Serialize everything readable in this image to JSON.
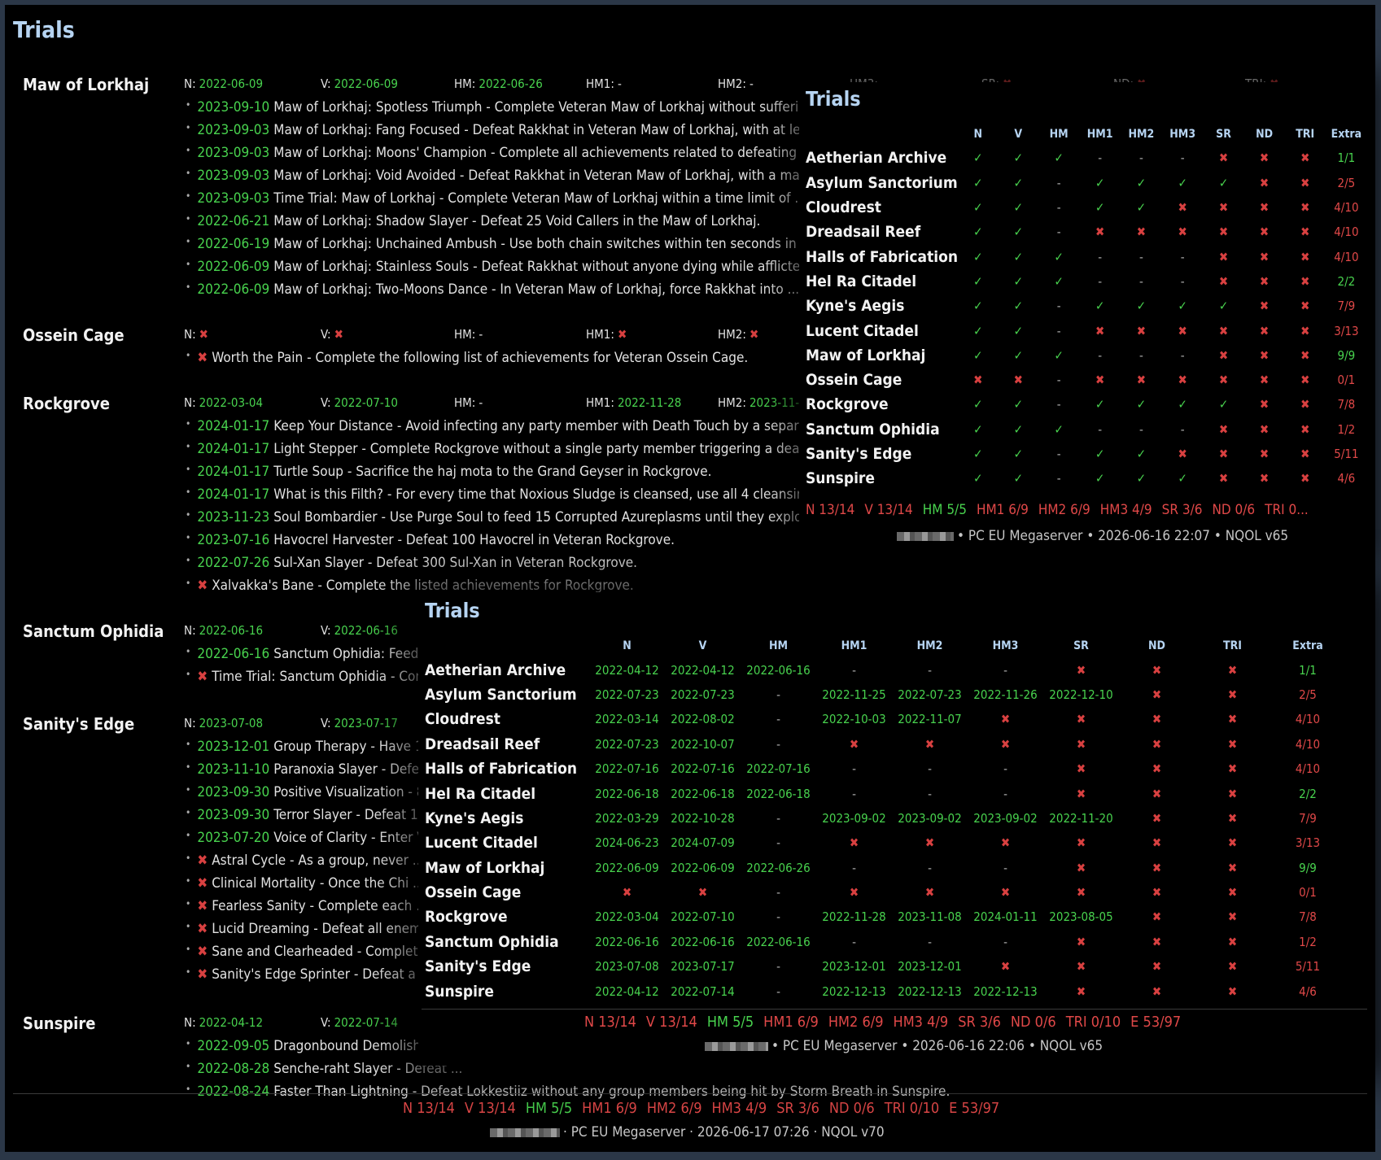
{
  "main": {
    "title": "Trials",
    "trials": [
      {
        "name": "Maw of Lorkhaj",
        "stats": [
          {
            "label": "N:",
            "value": "2022-06-09",
            "status": "date"
          },
          {
            "label": "V:",
            "value": "2022-06-09",
            "status": "date"
          },
          {
            "label": "HM:",
            "value": "2022-06-26",
            "status": "date"
          },
          {
            "label": "HM1:",
            "value": "-",
            "status": "dash"
          },
          {
            "label": "HM2:",
            "value": "-",
            "status": "dash"
          },
          {
            "label": "HM3:",
            "value": "-",
            "status": "dash"
          },
          {
            "label": "SR:",
            "value": "✖",
            "status": "x"
          },
          {
            "label": "ND:",
            "value": "✖",
            "status": "x"
          },
          {
            "label": "TRI:",
            "value": "✖",
            "status": "x"
          }
        ],
        "achievements": [
          {
            "date": "2023-09-10",
            "text": "Maw of Lorkhaj: Spotless Triumph - Complete Veteran Maw of Lorkhaj without suffering a death."
          },
          {
            "date": "2023-09-03",
            "text": "Maw of Lorkhaj: Fang Focused - Defeat Rakkhat in Veteran Maw of Lorkhaj, with at least ..."
          },
          {
            "date": "2023-09-03",
            "text": "Maw of Lorkhaj: Moons' Champion - Complete all achievements related to defeating Rakkhat."
          },
          {
            "date": "2023-09-03",
            "text": "Maw of Lorkhaj: Void Avoided - Defeat Rakkhat in Veteran Maw of Lorkhaj, with a maximum of ..."
          },
          {
            "date": "2023-09-03",
            "text": "Time Trial: Maw of Lorkhaj - Complete Veteran Maw of Lorkhaj within a time limit of ..."
          },
          {
            "date": "2022-06-21",
            "text": "Maw of Lorkhaj: Shadow Slayer - Defeat 25 Void Callers in the Maw of Lorkhaj."
          },
          {
            "date": "2022-06-19",
            "text": "Maw of Lorkhaj: Unchained Ambush - Use both chain switches within ten seconds in ..."
          },
          {
            "date": "2022-06-09",
            "text": "Maw of Lorkhaj: Stainless Souls - Defeat Rakkhat without anyone dying while afflicted ..."
          },
          {
            "date": "2022-06-09",
            "text": "Maw of Lorkhaj: Two-Moons Dance - In Veteran Maw of Lorkhaj, force Rakkhat into ..."
          }
        ]
      },
      {
        "name": "Ossein Cage",
        "stats": [
          {
            "label": "N:",
            "value": "✖",
            "status": "x"
          },
          {
            "label": "V:",
            "value": "✖",
            "status": "x"
          },
          {
            "label": "HM:",
            "value": "-",
            "status": "dash"
          },
          {
            "label": "HM1:",
            "value": "✖",
            "status": "x"
          },
          {
            "label": "HM2:",
            "value": "✖",
            "status": "x"
          }
        ],
        "achievements": [
          {
            "date": "",
            "text": "Worth the Pain - Complete the following list of achievements for Veteran Ossein Cage."
          }
        ]
      },
      {
        "name": "Rockgrove",
        "stats": [
          {
            "label": "N:",
            "value": "2022-03-04",
            "status": "date"
          },
          {
            "label": "V:",
            "value": "2022-07-10",
            "status": "date"
          },
          {
            "label": "HM:",
            "value": "-",
            "status": "dash"
          },
          {
            "label": "HM1:",
            "value": "2022-11-28",
            "status": "date"
          },
          {
            "label": "HM2:",
            "value": "2023-11-08",
            "status": "date"
          }
        ],
        "achievements": [
          {
            "date": "2024-01-17",
            "text": "Keep Your Distance - Avoid infecting any party member with Death Touch by a separation ..."
          },
          {
            "date": "2024-01-17",
            "text": "Light Stepper - Complete Rockgrove without a single party member triggering a deadly ..."
          },
          {
            "date": "2024-01-17",
            "text": "Turtle Soup - Sacrifice the haj mota to the Grand Geyser in Rockgrove."
          },
          {
            "date": "2024-01-17",
            "text": "What is this Filth? - For every time that Noxious Sludge is cleansed, use all 4 cleansing ..."
          },
          {
            "date": "2023-11-23",
            "text": "Soul Bombardier - Use Purge Soul to feed 15 Corrupted Azureplasms until they explode ..."
          },
          {
            "date": "2023-07-16",
            "text": "Havocrel Harvester - Defeat 100 Havocrel in Veteran Rockgrove."
          },
          {
            "date": "2022-07-26",
            "text": "Sul-Xan Slayer - Defeat 300 Sul-Xan in Veteran Rockgrove."
          },
          {
            "date": "",
            "text": "Xalvakka's Bane - Complete the listed achievements for Rockgrove."
          }
        ]
      },
      {
        "name": "Sanctum Ophidia",
        "stats": [
          {
            "label": "N:",
            "value": "2022-06-16",
            "status": "date"
          },
          {
            "label": "V:",
            "value": "2022-06-16",
            "status": "date"
          }
        ],
        "achievements": [
          {
            "date": "2022-06-16",
            "text": "Sanctum Ophidia: Feeding ..."
          },
          {
            "date": "",
            "text": "Time Trial: Sanctum Ophidia - Complete ..."
          }
        ]
      },
      {
        "name": "Sanity's Edge",
        "stats": [
          {
            "label": "N:",
            "value": "2023-07-08",
            "status": "date"
          },
          {
            "label": "V:",
            "value": "2023-07-17",
            "status": "date"
          }
        ],
        "achievements": [
          {
            "date": "2023-12-01",
            "text": "Group Therapy - Have 11 ..."
          },
          {
            "date": "2023-11-10",
            "text": "Paranoxia Slayer - Defeat ..."
          },
          {
            "date": "2023-09-30",
            "text": "Positive Visualization - 8 ..."
          },
          {
            "date": "2023-09-30",
            "text": "Terror Slayer - Defeat 12 ..."
          },
          {
            "date": "2023-07-20",
            "text": "Voice of Clarity - Enter V ..."
          },
          {
            "date": "",
            "text": "Astral Cycle - As a group, never ..."
          },
          {
            "date": "",
            "text": "Clinical Mortality - Once the Chi ..."
          },
          {
            "date": "",
            "text": "Fearless Sanity - Complete each ..."
          },
          {
            "date": "",
            "text": "Lucid Dreaming - Defeat all enem ..."
          },
          {
            "date": "",
            "text": "Sane and Clearheaded - Complete ..."
          },
          {
            "date": "",
            "text": "Sanity's Edge Sprinter - Defeat a ..."
          }
        ]
      },
      {
        "name": "Sunspire",
        "stats": [
          {
            "label": "N:",
            "value": "2022-04-12",
            "status": "date"
          },
          {
            "label": "V:",
            "value": "2022-07-14",
            "status": "date"
          }
        ],
        "achievements": [
          {
            "date": "2022-09-05",
            "text": "Dragonbound Demolisher - ..."
          },
          {
            "date": "2022-08-28",
            "text": "Senche-raht Slayer - Defeat ..."
          },
          {
            "date": "2022-08-24",
            "text": "Faster Than Lightning - Defeat Lokkestiiz without any group members being hit by Storm Breath in Sunspire."
          }
        ]
      }
    ],
    "summary": [
      {
        "text": "N 13/14",
        "status": "red"
      },
      {
        "text": "V 13/14",
        "status": "red"
      },
      {
        "text": "HM 5/5",
        "status": "green"
      },
      {
        "text": "HM1 6/9",
        "status": "red"
      },
      {
        "text": "HM2 6/9",
        "status": "red"
      },
      {
        "text": "HM3 4/9",
        "status": "red"
      },
      {
        "text": "SR 3/6",
        "status": "red"
      },
      {
        "text": "ND 0/6",
        "status": "red"
      },
      {
        "text": "TRI 0/10",
        "status": "red"
      },
      {
        "text": "E 53/97",
        "status": "red"
      }
    ],
    "footer": "· PC EU Megaserver · 2026-06-17 07:26 · NQOL v70"
  },
  "overlay1": {
    "title": "Trials",
    "columns": [
      "N",
      "V",
      "HM",
      "HM1",
      "HM2",
      "HM3",
      "SR",
      "ND",
      "TRI",
      "Extra"
    ],
    "rows": [
      {
        "name": "Aetherian Archive",
        "cells": [
          "✓",
          "✓",
          "✓",
          "-",
          "-",
          "-",
          "✖",
          "✖",
          "✖"
        ],
        "extra": "1/1"
      },
      {
        "name": "Asylum Sanctorium",
        "cells": [
          "✓",
          "✓",
          "-",
          "✓",
          "✓",
          "✓",
          "✓",
          "✖",
          "✖"
        ],
        "extra": "2/5"
      },
      {
        "name": "Cloudrest",
        "cells": [
          "✓",
          "✓",
          "-",
          "✓",
          "✓",
          "✖",
          "✖",
          "✖",
          "✖"
        ],
        "extra": "4/10"
      },
      {
        "name": "Dreadsail Reef",
        "cells": [
          "✓",
          "✓",
          "-",
          "✖",
          "✖",
          "✖",
          "✖",
          "✖",
          "✖"
        ],
        "extra": "4/10"
      },
      {
        "name": "Halls of Fabrication",
        "cells": [
          "✓",
          "✓",
          "✓",
          "-",
          "-",
          "-",
          "✖",
          "✖",
          "✖"
        ],
        "extra": "4/10"
      },
      {
        "name": "Hel Ra Citadel",
        "cells": [
          "✓",
          "✓",
          "✓",
          "-",
          "-",
          "-",
          "✖",
          "✖",
          "✖"
        ],
        "extra": "2/2"
      },
      {
        "name": "Kyne's Aegis",
        "cells": [
          "✓",
          "✓",
          "-",
          "✓",
          "✓",
          "✓",
          "✓",
          "✖",
          "✖"
        ],
        "extra": "7/9"
      },
      {
        "name": "Lucent Citadel",
        "cells": [
          "✓",
          "✓",
          "-",
          "✖",
          "✖",
          "✖",
          "✖",
          "✖",
          "✖"
        ],
        "extra": "3/13"
      },
      {
        "name": "Maw of Lorkhaj",
        "cells": [
          "✓",
          "✓",
          "✓",
          "-",
          "-",
          "-",
          "✖",
          "✖",
          "✖"
        ],
        "extra": "9/9"
      },
      {
        "name": "Ossein Cage",
        "cells": [
          "✖",
          "✖",
          "-",
          "✖",
          "✖",
          "✖",
          "✖",
          "✖",
          "✖"
        ],
        "extra": "0/1"
      },
      {
        "name": "Rockgrove",
        "cells": [
          "✓",
          "✓",
          "-",
          "✓",
          "✓",
          "✓",
          "✓",
          "✖",
          "✖"
        ],
        "extra": "7/8"
      },
      {
        "name": "Sanctum Ophidia",
        "cells": [
          "✓",
          "✓",
          "✓",
          "-",
          "-",
          "-",
          "✖",
          "✖",
          "✖"
        ],
        "extra": "1/2"
      },
      {
        "name": "Sanity's Edge",
        "cells": [
          "✓",
          "✓",
          "-",
          "✓",
          "✓",
          "✖",
          "✖",
          "✖",
          "✖"
        ],
        "extra": "5/11"
      },
      {
        "name": "Sunspire",
        "cells": [
          "✓",
          "✓",
          "-",
          "✓",
          "✓",
          "✓",
          "✖",
          "✖",
          "✖"
        ],
        "extra": "4/6"
      }
    ],
    "summary": [
      {
        "text": "N 13/14",
        "status": "red"
      },
      {
        "text": "V 13/14",
        "status": "red"
      },
      {
        "text": "HM 5/5",
        "status": "green"
      },
      {
        "text": "HM1 6/9",
        "status": "red"
      },
      {
        "text": "HM2 6/9",
        "status": "red"
      },
      {
        "text": "HM3 4/9",
        "status": "red"
      },
      {
        "text": "SR 3/6",
        "status": "red"
      },
      {
        "text": "ND 0/6",
        "status": "red"
      },
      {
        "text": "TRI 0...",
        "status": "red"
      }
    ],
    "footer": "• PC EU Megaserver • 2026-06-16 22:07 • NQOL v65"
  },
  "overlay2": {
    "title": "Trials",
    "columns": [
      "N",
      "V",
      "HM",
      "HM1",
      "HM2",
      "HM3",
      "SR",
      "ND",
      "TRI",
      "Extra"
    ],
    "rows": [
      {
        "name": "Aetherian Archive",
        "cells": [
          "2022-04-12",
          "2022-04-12",
          "2022-06-16",
          "-",
          "-",
          "-",
          "✖",
          "✖",
          "✖"
        ],
        "extra": "1/1"
      },
      {
        "name": "Asylum Sanctorium",
        "cells": [
          "2022-07-23",
          "2022-07-23",
          "-",
          "2022-11-25",
          "2022-07-23",
          "2022-11-26",
          "2022-12-10",
          "✖",
          "✖"
        ],
        "extra": "2/5"
      },
      {
        "name": "Cloudrest",
        "cells": [
          "2022-03-14",
          "2022-08-02",
          "-",
          "2022-10-03",
          "2022-11-07",
          "✖",
          "✖",
          "✖",
          "✖"
        ],
        "extra": "4/10"
      },
      {
        "name": "Dreadsail Reef",
        "cells": [
          "2022-07-23",
          "2022-10-07",
          "-",
          "✖",
          "✖",
          "✖",
          "✖",
          "✖",
          "✖"
        ],
        "extra": "4/10"
      },
      {
        "name": "Halls of Fabrication",
        "cells": [
          "2022-07-16",
          "2022-07-16",
          "2022-07-16",
          "-",
          "-",
          "-",
          "✖",
          "✖",
          "✖"
        ],
        "extra": "4/10"
      },
      {
        "name": "Hel Ra Citadel",
        "cells": [
          "2022-06-18",
          "2022-06-18",
          "2022-06-18",
          "-",
          "-",
          "-",
          "✖",
          "✖",
          "✖"
        ],
        "extra": "2/2"
      },
      {
        "name": "Kyne's Aegis",
        "cells": [
          "2022-03-29",
          "2022-10-28",
          "-",
          "2023-09-02",
          "2023-09-02",
          "2023-09-02",
          "2022-11-20",
          "✖",
          "✖"
        ],
        "extra": "7/9"
      },
      {
        "name": "Lucent Citadel",
        "cells": [
          "2024-06-23",
          "2024-07-09",
          "-",
          "✖",
          "✖",
          "✖",
          "✖",
          "✖",
          "✖"
        ],
        "extra": "3/13"
      },
      {
        "name": "Maw of Lorkhaj",
        "cells": [
          "2022-06-09",
          "2022-06-09",
          "2022-06-26",
          "-",
          "-",
          "-",
          "✖",
          "✖",
          "✖"
        ],
        "extra": "9/9"
      },
      {
        "name": "Ossein Cage",
        "cells": [
          "✖",
          "✖",
          "-",
          "✖",
          "✖",
          "✖",
          "✖",
          "✖",
          "✖"
        ],
        "extra": "0/1"
      },
      {
        "name": "Rockgrove",
        "cells": [
          "2022-03-04",
          "2022-07-10",
          "-",
          "2022-11-28",
          "2023-11-08",
          "2024-01-11",
          "2023-08-05",
          "✖",
          "✖"
        ],
        "extra": "7/8"
      },
      {
        "name": "Sanctum Ophidia",
        "cells": [
          "2022-06-16",
          "2022-06-16",
          "2022-06-16",
          "-",
          "-",
          "-",
          "✖",
          "✖",
          "✖"
        ],
        "extra": "1/2"
      },
      {
        "name": "Sanity's Edge",
        "cells": [
          "2023-07-08",
          "2023-07-17",
          "-",
          "2023-12-01",
          "2023-12-01",
          "✖",
          "✖",
          "✖",
          "✖"
        ],
        "extra": "5/11"
      },
      {
        "name": "Sunspire",
        "cells": [
          "2022-04-12",
          "2022-07-14",
          "-",
          "2022-12-13",
          "2022-12-13",
          "2022-12-13",
          "✖",
          "✖",
          "✖"
        ],
        "extra": "4/6"
      }
    ],
    "summary": [
      {
        "text": "N 13/14",
        "status": "red"
      },
      {
        "text": "V 13/14",
        "status": "red"
      },
      {
        "text": "HM 5/5",
        "status": "green"
      },
      {
        "text": "HM1 6/9",
        "status": "red"
      },
      {
        "text": "HM2 6/9",
        "status": "red"
      },
      {
        "text": "HM3 4/9",
        "status": "red"
      },
      {
        "text": "SR 3/6",
        "status": "red"
      },
      {
        "text": "ND 0/6",
        "status": "red"
      },
      {
        "text": "TRI 0/10",
        "status": "red"
      },
      {
        "text": "E 53/97",
        "status": "red"
      }
    ],
    "footer": "• PC EU Megaserver • 2026-06-16 22:06 • NQOL v65"
  },
  "colors": {
    "background": "#2b3747",
    "title": "#b6d4f2",
    "green": "#48d24e",
    "red": "#e04848"
  }
}
